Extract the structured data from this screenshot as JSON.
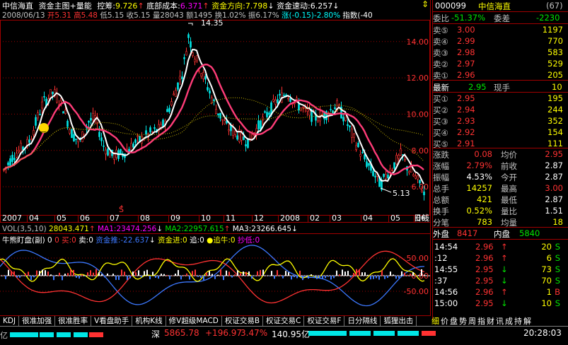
{
  "header": {
    "stock_name": "中信海直",
    "indicator_title": "资金主图+量能",
    "kong_chou_label": "控筹:",
    "kong_chou_value": "9.726",
    "bottom_cost_label": "底部成本:",
    "bottom_cost_value": "6.371",
    "fund_direction_label": "资金方向:",
    "fund_direction_value": "7.798",
    "fund_speed_label": "资金速动:",
    "fund_speed_value": "6.257"
  },
  "info_line": {
    "date": "2008/06/13",
    "open_label": "开",
    "open": "5.31",
    "high_label": "高",
    "high": "5.48",
    "low_label": "低",
    "low": "5.15",
    "close_label": "收",
    "close": "5.15",
    "volume_label": "量",
    "volume": "28043",
    "amount_label": "额",
    "amount": "1495",
    "turnover_label": "换",
    "turnover": "1.02%",
    "amplitude_label": "振",
    "amplitude": "6.17%",
    "change_label": "涨",
    "change": "(-0.15)-2.80%",
    "index_label": "指数",
    "index_value": "(-40"
  },
  "price_axis": [
    "14.00",
    "12.00",
    "10.00",
    "8.00",
    "6.00"
  ],
  "price_annotations": {
    "high": "14.35",
    "low": "5.13"
  },
  "time_axis": [
    "2007",
    "04",
    "05",
    "06",
    "07",
    "08",
    "09",
    "10",
    "11",
    "12",
    "2008",
    "02",
    "03",
    "04",
    "05",
    "06",
    "日线"
  ],
  "vol_line": {
    "label": "VOL(3,5,10)",
    "vol": "28043.471",
    "ma1_label": "MA1:",
    "ma1": "23474.256",
    "ma2_label": "MA2:",
    "ma2": "22957.615",
    "ma3_label": "MA3:",
    "ma3": "23266.645"
  },
  "sub_indicator": {
    "title": "牛熊盯盘(副)",
    "v1": "0",
    "v2": "0",
    "buy_label": "买:",
    "buy_value": "0",
    "sell_label": "卖:",
    "sell_value": "0",
    "fund_push_label": "资金推:",
    "fund_push_value": "-22.637",
    "fund_in_label": "资金进:",
    "fund_in_value": "0",
    "chase_label": "追:",
    "chase_value": "0",
    "chase_bull_label": "追牛:",
    "chase_bull_value": "0",
    "bottom_label": "抄低:",
    "bottom_value": "0",
    "axis": [
      "50.00",
      "0.00",
      "-50.00"
    ]
  },
  "quote_panel": {
    "code": "000099",
    "name": "中信海直",
    "page": "(67)",
    "weibi_label": "委比",
    "weibi": "-51.37%",
    "weicha_label": "委差",
    "weicha": "-2230",
    "sell_levels": [
      {
        "label": "卖⑤",
        "price": "3.00",
        "vol": "1197"
      },
      {
        "label": "卖④",
        "price": "2.99",
        "vol": "770"
      },
      {
        "label": "卖③",
        "price": "2.98",
        "vol": "583"
      },
      {
        "label": "卖②",
        "price": "2.97",
        "vol": "529"
      },
      {
        "label": "卖①",
        "price": "2.96",
        "vol": "205"
      }
    ],
    "latest_label": "最新",
    "latest": "2.95",
    "current_vol_label": "现手",
    "current_vol": "10",
    "buy_levels": [
      {
        "label": "买①",
        "price": "2.95",
        "vol": "195"
      },
      {
        "label": "买②",
        "price": "2.94",
        "vol": "244"
      },
      {
        "label": "买③",
        "price": "2.93",
        "vol": "352"
      },
      {
        "label": "买④",
        "price": "2.92",
        "vol": "154"
      },
      {
        "label": "买⑤",
        "price": "2.91",
        "vol": "111"
      }
    ],
    "stats": [
      {
        "l1": "涨跌",
        "v1": "0.08",
        "l2": "均价",
        "v2": "2.95"
      },
      {
        "l1": "涨幅",
        "v1": "2.79%",
        "l2": "前收",
        "v2": "2.87"
      },
      {
        "l1": "振幅",
        "v1": "4.53%",
        "l2": "今开",
        "v2": "2.87"
      },
      {
        "l1": "总手",
        "v1": "14257",
        "l2": "最高",
        "v2": "3.00"
      },
      {
        "l1": "总额",
        "v1": "421",
        "l2": "最低",
        "v2": "2.87"
      },
      {
        "l1": "换手",
        "v1": "0.52%",
        "l2": "量比",
        "v2": "1.51"
      },
      {
        "l1": "分笔",
        "v1": "783",
        "l2": "均量",
        "v2": "18"
      }
    ],
    "outer_label": "外盘",
    "outer": "8417",
    "inner_label": "内盘",
    "inner": "5840",
    "ticks": [
      {
        "time": "14:54",
        "price": "2.96",
        "vol": "20",
        "side": "S"
      },
      {
        "time": ":12",
        "price": "2.96",
        "vol": "6",
        "side": "S"
      },
      {
        "time": "14:55",
        "price": "2.95",
        "vol": "73",
        "side": "S"
      },
      {
        "time": ":37",
        "price": "2.95",
        "vol": "70",
        "side": "S"
      },
      {
        "time": "14:56",
        "price": "2.96",
        "vol": "1",
        "side": "B"
      },
      {
        "time": "15:00",
        "price": "2.95",
        "vol": "10",
        "side": "S"
      }
    ]
  },
  "tabs": [
    "KDJ",
    "很准加强",
    "很准胜率",
    "V看盘助手",
    "机构K线",
    "修V超级MACD",
    "权证交易B",
    "权证交易C",
    "权证交易F",
    "日分隔线",
    "狐狸出击"
  ],
  "right_tabs": [
    "细",
    "价",
    "盘",
    "势",
    "周",
    "指",
    "财",
    "讯",
    "成",
    "持",
    "解"
  ],
  "status_bar": {
    "left_unit": "亿",
    "market_label": "深",
    "index_value": "5865.78",
    "index_change": "+196.97",
    "index_pct": "3.47%",
    "amount": "140.95亿",
    "time": "20:28:03"
  },
  "colors": {
    "up": "#ff3232",
    "down": "#00e600",
    "ma_white": "#ffffff",
    "ma_pink": "#ff3c78",
    "ma_olive": "#c8b400",
    "grid": "#a00000"
  }
}
